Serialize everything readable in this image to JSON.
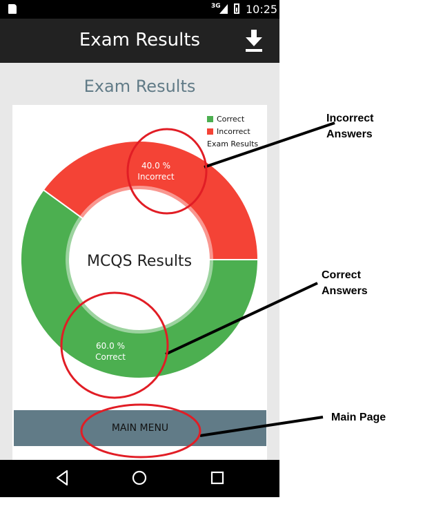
{
  "status_bar": {
    "network": "3G",
    "time": "10:25"
  },
  "app_bar": {
    "title": "Exam Results",
    "action_icon": "download-icon"
  },
  "page": {
    "heading": "Exam Results"
  },
  "chart": {
    "center_label": "MCQS Results",
    "legend_title": "Exam Results",
    "colors": {
      "correct": "#4caf50",
      "incorrect": "#f44336"
    },
    "incorrect_text": {
      "percent": "40.0 %",
      "label": "Incorrect"
    },
    "correct_text": {
      "percent": "60.0 %",
      "label": "Correct"
    }
  },
  "chart_data": {
    "type": "pie",
    "title": "Exam Results",
    "categories": [
      "Correct",
      "Incorrect"
    ],
    "values": [
      60.0,
      40.0
    ],
    "legend": "top-right"
  },
  "buttons": {
    "main_menu": "MAIN MENU"
  },
  "navigation": {
    "icons": [
      "back-icon",
      "home-icon",
      "recents-icon"
    ]
  },
  "annotations": {
    "incorrect_line1": "Incorrect",
    "incorrect_line2": "Answers",
    "correct_line1": "Correct",
    "correct_line2": "Answers",
    "main_page": "Main Page",
    "highlight_color": "#e11d25"
  }
}
